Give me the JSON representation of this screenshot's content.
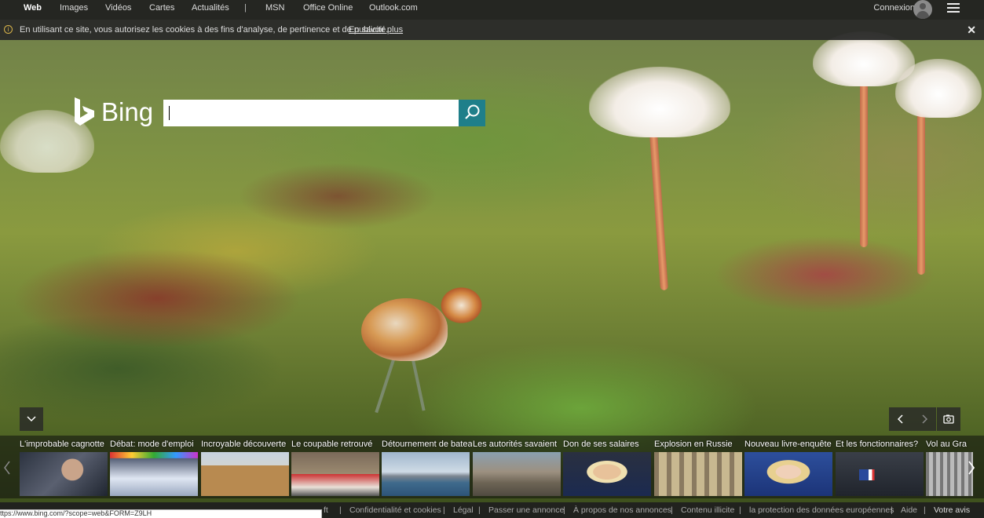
{
  "nav": {
    "items": [
      "Web",
      "Images",
      "Vidéos",
      "Cartes",
      "Actualités"
    ],
    "separator": "|",
    "items_right": [
      "MSN",
      "Office Online",
      "Outlook.com"
    ],
    "signin": "Connexion"
  },
  "cookie": {
    "text": "En utilisant ce site, vous autorisez les cookies à des fins d'analyse, de pertinence et de publicité.",
    "link": "En savoir plus",
    "close": "✕"
  },
  "brand": {
    "logo_text": "Bing",
    "accent": "#1f7f8a"
  },
  "search": {
    "value": "",
    "placeholder": ""
  },
  "news": [
    "L'improbable cagnotte",
    "Débat: mode d'emploi",
    "Incroyable découverte",
    "Le coupable retrouvé",
    "Détournement de bateau",
    "Les autorités savaient",
    "Don de ses salaires",
    "Explosion en Russie",
    "Nouveau livre-enquête",
    "Et les fonctionnaires?",
    "Vol au Gra"
  ],
  "footer": {
    "links": [
      "Confidentialité et cookies",
      "Légal",
      "Passer une annonce",
      "À propos de nos annonces",
      "Contenu illicite",
      "la protection des données européennes",
      "Aide"
    ],
    "feedback": "Votre avis",
    "partial": "ft"
  },
  "status_url": "ttps://www.bing.com/?scope=web&FORM=Z9LH"
}
